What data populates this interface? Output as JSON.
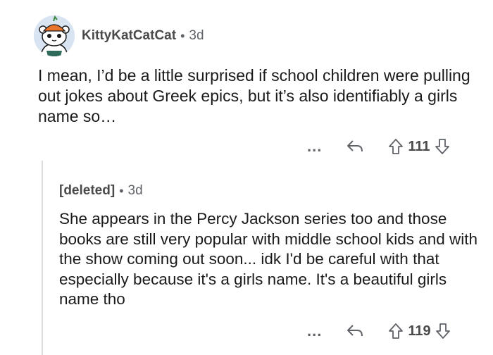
{
  "comment_parent": {
    "username": "KittyKatCatCat",
    "separator": "•",
    "time": "3d",
    "body": "I mean, I’d be a little surprised if school children were pulling out jokes about Greek epics, but it’s also identifiably a girls name so…",
    "more_label": "...",
    "reply_icon": "reply-arrow-icon",
    "upvote_icon": "arrow-up-icon",
    "downvote_icon": "arrow-down-icon",
    "votes": "111"
  },
  "comment_reply": {
    "username": "[deleted]",
    "separator": "•",
    "time": "3d",
    "body": "She appears in the Percy Jackson series too and those books are still very popular with middle school kids and with the show coming out soon... idk I'd be careful with that especially because it's a girls name. It's a beautiful girls name tho",
    "more_label": "...",
    "votes": "119"
  },
  "colors": {
    "text": "#1a1a1b",
    "meta": "#5f6368",
    "thread_line": "#dadce0",
    "avatar_bg": "#d8e4f2"
  }
}
